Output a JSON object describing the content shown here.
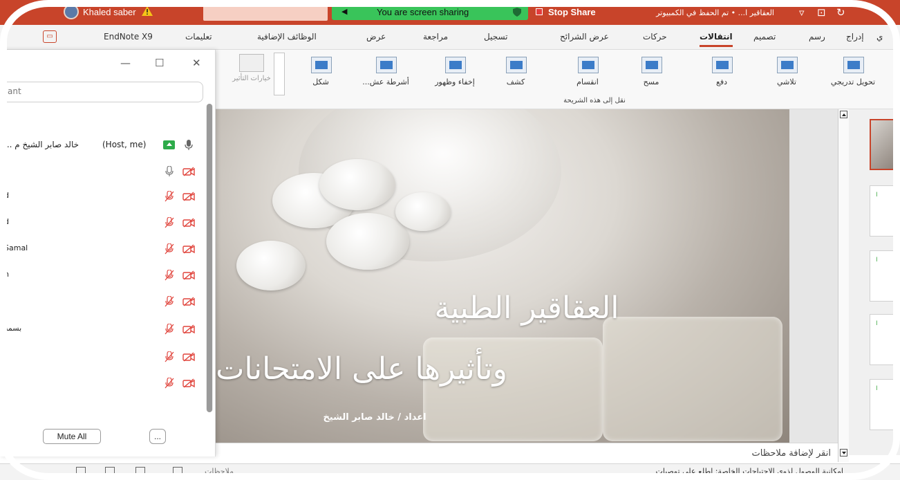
{
  "titlebar": {
    "user_name": "Khaled saber",
    "share_banner": "You are screen sharing",
    "stop_share": "Stop Share",
    "doc_title": "العقاقير ا... • تم الحفظ في الكمبيوتر"
  },
  "tabs": [
    {
      "label": "ي"
    },
    {
      "label": "إدراج"
    },
    {
      "label": "رسم"
    },
    {
      "label": "تصميم"
    },
    {
      "label": "انتقالات",
      "active": true
    },
    {
      "label": "حركات"
    },
    {
      "label": "عرض الشرائح"
    },
    {
      "label": "تسجيل"
    },
    {
      "label": "مراجعة"
    },
    {
      "label": "عرض"
    },
    {
      "label": "الوظائف الإضافية"
    },
    {
      "label": "تعليمات"
    },
    {
      "label": "EndNote X9"
    }
  ],
  "ribbon": {
    "transitions": [
      {
        "label": "تحويل تدريجي"
      },
      {
        "label": "تلاشي"
      },
      {
        "label": "دفع"
      },
      {
        "label": "مسح"
      },
      {
        "label": "انقسام"
      },
      {
        "label": "كشف"
      },
      {
        "label": "إخفاء وظهور"
      },
      {
        "label": "أشرطة عش..."
      },
      {
        "label": "شكل"
      }
    ],
    "effect_options": "خيارات التأثير",
    "group_label": "نقل إلى هذه الشريحة"
  },
  "slide": {
    "title_line1": "العقاقير الطبية",
    "title_line2": "وتأثيرها على الامتحانات",
    "author": "اعداد / خالد صابر الشيخ"
  },
  "notes": {
    "placeholder": "انقر لإضافة ملاحظات"
  },
  "statusbar": {
    "notes_button": "ملاحظات",
    "accessibility": "إمكانية الوصول لذوي الاحتياجات الخاصة: اطلع على توصيات"
  },
  "participants": {
    "search_placeholder": "ant",
    "host": {
      "name": "خالد صابر الشيخ م ...",
      "label": "(Host, me)"
    },
    "rows": [
      {
        "name": ""
      },
      {
        "name": "d"
      },
      {
        "name": "d"
      },
      {
        "name": "Samal"
      },
      {
        "name": "n"
      },
      {
        "name": ""
      },
      {
        "name": "بسمه"
      },
      {
        "name": ""
      },
      {
        "name": ""
      }
    ],
    "mute_all": "Mute All",
    "more": "..."
  },
  "thumbnails": [
    {
      "num": "",
      "selected": true
    },
    {
      "num": "I"
    },
    {
      "num": "I"
    },
    {
      "num": "I"
    },
    {
      "num": "I"
    }
  ],
  "colors": {
    "accent": "#c8442a",
    "share_green": "#39c45a"
  }
}
